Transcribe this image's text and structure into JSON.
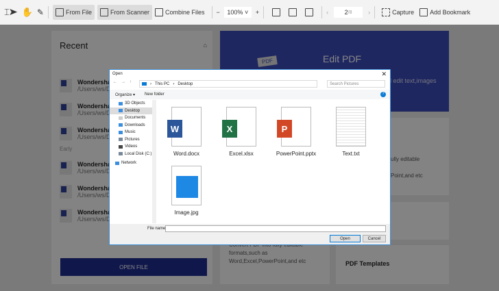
{
  "toolbar": {
    "from_file": "From File",
    "from_scanner": "From Scanner",
    "combine": "Combine Files",
    "zoom": "100%",
    "page_current": "2",
    "page_total": "/8",
    "capture": "Capture",
    "bookmark": "Add Bookmark"
  },
  "recent": {
    "title": "Recent",
    "early": "Early",
    "open_file": "OPEN FILE",
    "items": [
      {
        "name": "Wondershar",
        "path": "/Users/ws/D"
      },
      {
        "name": "Wondershar",
        "path": "/Users/ws/D"
      },
      {
        "name": "Wondershar",
        "path": "/Users/ws/D"
      },
      {
        "name": "Wondershar",
        "path": "/Users/ws/D"
      },
      {
        "name": "Wondershar",
        "path": "/Users/ws/D"
      },
      {
        "name": "Wondershar",
        "path": "/Users/ws/D"
      }
    ]
  },
  "edit": {
    "title": "Edit PDF",
    "desc": "d edit text,images",
    "badge": "PDF"
  },
  "convert": {
    "desc1": "ully editable",
    "desc2": "Point,and etc",
    "full": "Convert PDF into fully editable formats,such as Word,Excel,PowerPoint,and etc"
  },
  "templates": {
    "title": "PDF Templates"
  },
  "dialog": {
    "title": "Open",
    "path": [
      "This PC",
      "Desktop"
    ],
    "search_placeholder": "Search Pictures",
    "organize": "Organize ▾",
    "new_folder": "New folder",
    "nav": [
      "3D Objects",
      "Desktop",
      "Documents",
      "Downloads",
      "Music",
      "Pictures",
      "Videos",
      "Local Disk (C:)",
      "Network"
    ],
    "files": [
      {
        "name": "Word.docx",
        "letter": "W",
        "color": "#2b579a"
      },
      {
        "name": "Excel.xlsx",
        "letter": "X",
        "color": "#217346"
      },
      {
        "name": "PowerPoint.pptx",
        "letter": "P",
        "color": "#d24726"
      },
      {
        "name": "Text.txt",
        "letter": "",
        "color": ""
      },
      {
        "name": "Image.jpg",
        "letter": "",
        "color": "#1e88e5"
      }
    ],
    "filename_label": "File name:",
    "filename_value": "",
    "open": "Open",
    "cancel": "Cancel"
  }
}
